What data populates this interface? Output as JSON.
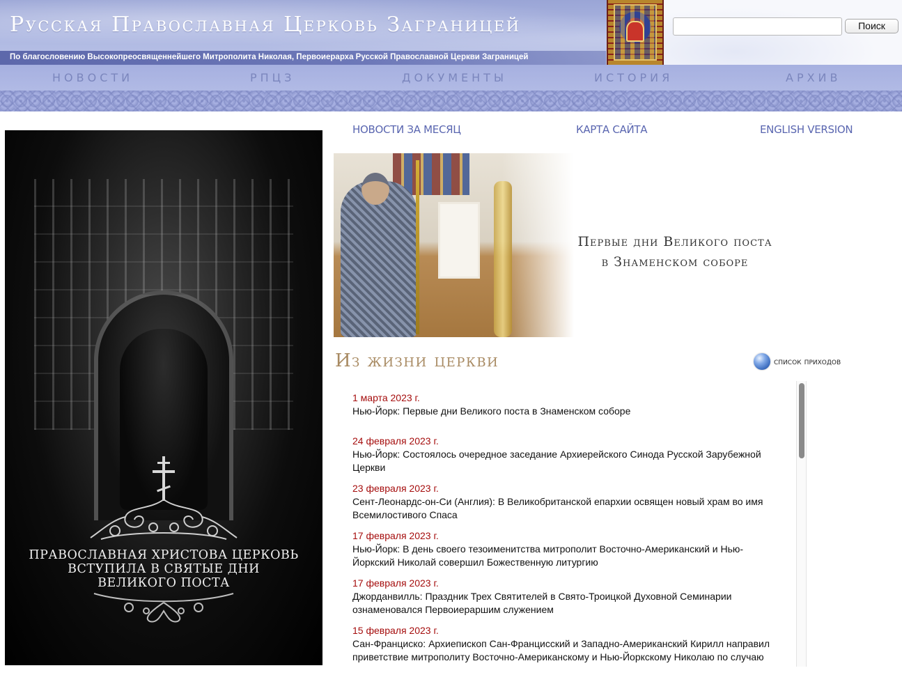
{
  "header": {
    "site_title": "Русская Православная Церковь Заграницей",
    "blessing": "По благословению Высокопреосвященнейшего Митрополита Николая, Первоиерарха Русской Православной Церкви Заграницей",
    "search": {
      "value": "",
      "placeholder": "",
      "button_label": "Поиск"
    }
  },
  "nav": {
    "items": [
      {
        "label": "НОВОСТИ"
      },
      {
        "label": "РПЦЗ"
      },
      {
        "label": "ДОКУМЕНТЫ"
      },
      {
        "label": "ИСТОРИЯ"
      },
      {
        "label": "АРХИВ"
      }
    ]
  },
  "sub_links": {
    "monthly_news": "НОВОСТИ ЗА МЕСЯЦ",
    "site_map": "КАРТА САЙТА",
    "english_version": "ENGLISH VERSION"
  },
  "poster": {
    "lines": [
      "ПРАВОСЛАВНАЯ ХРИСТОВА ЦЕРКОВЬ",
      "ВСТУПИЛА В СВЯТЫЕ ДНИ",
      "ВЕЛИКОГО ПОСТА"
    ]
  },
  "feature": {
    "caption_lines": [
      "Первые дни Великого поста",
      "в Знаменском соборе"
    ]
  },
  "section": {
    "title": "Из жизни церкви",
    "parishes_link": "список приходов"
  },
  "news": [
    {
      "date": "1 марта 2023 г.",
      "title_lines": [
        "Нью-Йорк: Первые дни Великого поста в Знаменском соборе"
      ]
    },
    {
      "date": "24 февраля 2023 г.",
      "title_lines": [
        "Нью-Йорк: Состоялось очередное заседание Архиерейского Синода Русской Зарубежной",
        "Церкви"
      ]
    },
    {
      "date": "23 февраля 2023 г.",
      "title_lines": [
        "Сент-Леонардс-он-Си (Англия): В Великобританской епархии освящен новый храм во имя",
        "Всемилостивого Спаса"
      ]
    },
    {
      "date": "17 февраля 2023 г.",
      "title_lines": [
        "Нью-Йорк: В день своего тезоименитства митрополит Восточно-Американский и Нью-",
        "Йоркский Николай совершил Божественную литургию"
      ]
    },
    {
      "date": "17 февраля 2023 г.",
      "title_lines": [
        "Джорданвилль: Праздник Трех Святителей в Свято-Троицкой Духовной Семинарии",
        "ознаменовался Первоиерaршим служением"
      ]
    },
    {
      "date": "15 февраля 2023 г.",
      "title_lines": [
        "Сан-Франциско: Архиепископ Сан-Францисский и Западно-Американский Кирилл направил",
        "приветствие митрополиту Восточно-Американскому и Нью-Йоркскому Николаю по случаю"
      ]
    }
  ],
  "colors": {
    "header_blue": "#aeb8e2",
    "nav_text": "#7b86bd",
    "link_blue": "#5a66b0",
    "date_red": "#a50d0d",
    "section_title_gold": "#a88a62"
  },
  "icons": {
    "globe": "globe-icon",
    "cross": "orthodox-cross-icon"
  }
}
